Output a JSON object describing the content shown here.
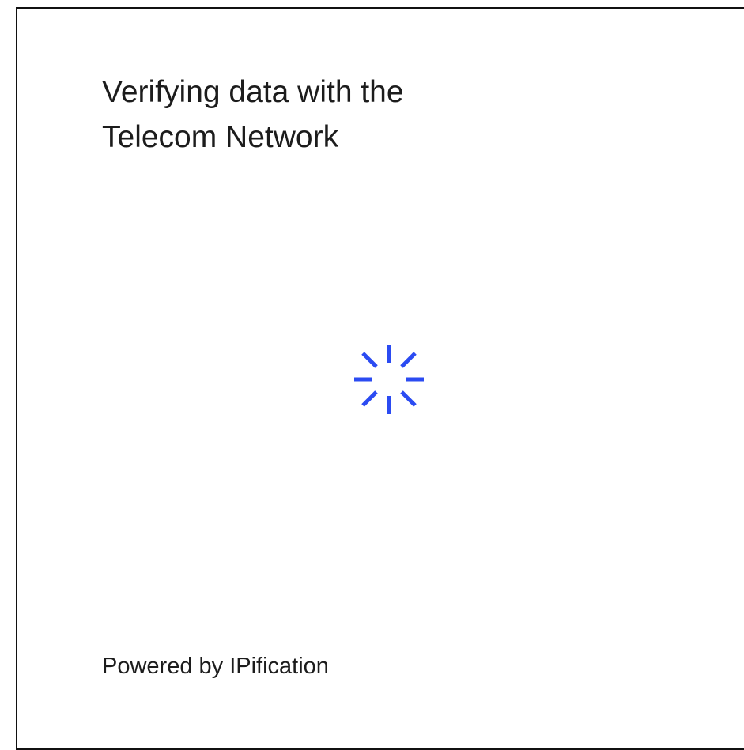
{
  "screen": {
    "title_line1": "Verifying data with the",
    "title_line2": "Telecom Network",
    "footer": "Powered by IPification"
  },
  "spinner": {
    "icon": "loading-spinner-icon",
    "color": "#2B4BF2"
  },
  "colors": {
    "background": "#FFFFFF",
    "text": "#1C1C1C",
    "frame_border": "#111111"
  }
}
